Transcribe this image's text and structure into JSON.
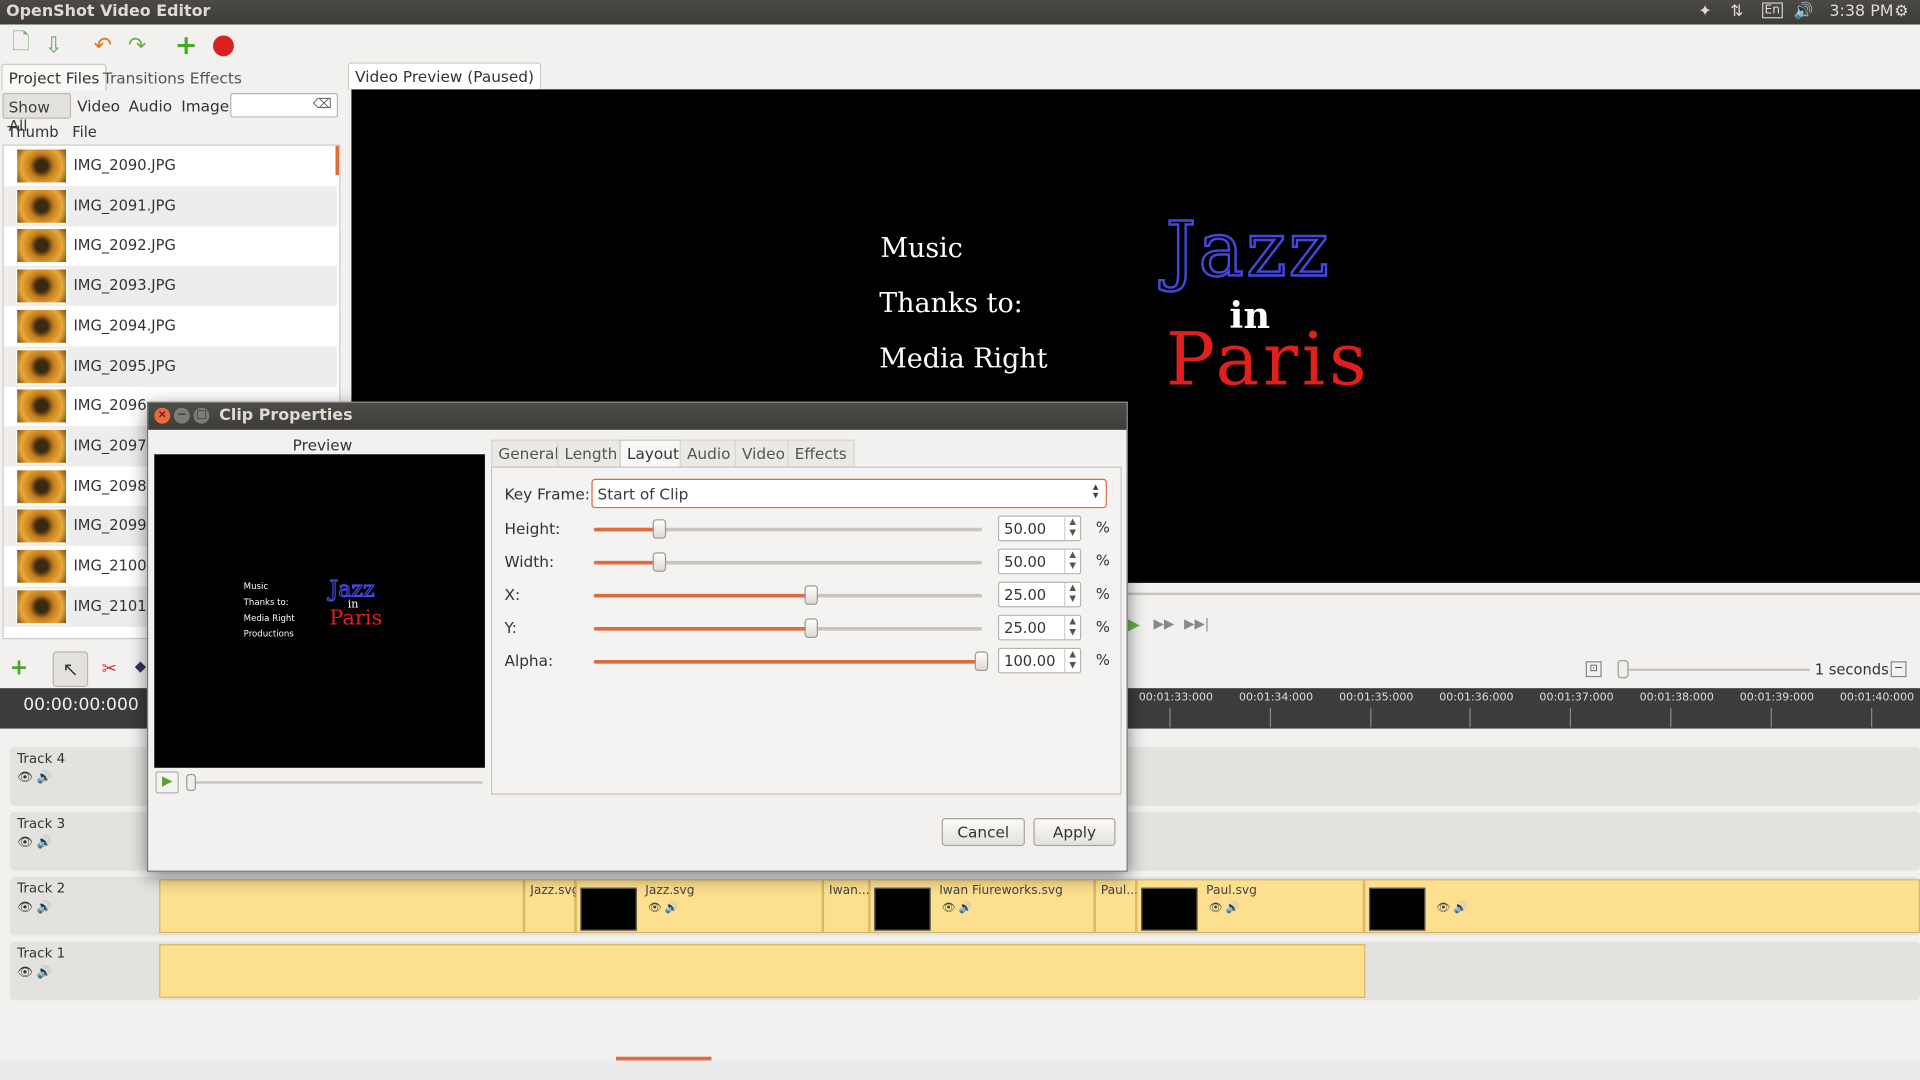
{
  "app": {
    "title": "OpenShot Video Editor"
  },
  "top_panel": {
    "keyboard": "En",
    "clock": "3:38 PM"
  },
  "left_tabs": [
    "Project Files",
    "Transitions",
    "Effects"
  ],
  "filters": {
    "show_all": "Show All",
    "video": "Video",
    "audio": "Audio",
    "image": "Image",
    "search_placeholder": ""
  },
  "file_columns": {
    "thumb": "Thumb",
    "file": "File"
  },
  "files": [
    "IMG_2090.JPG",
    "IMG_2091.JPG",
    "IMG_2092.JPG",
    "IMG_2093.JPG",
    "IMG_2094.JPG",
    "IMG_2095.JPG",
    "IMG_2096...",
    "IMG_2097...",
    "IMG_2098...",
    "IMG_2099...",
    "IMG_2100...",
    "IMG_2101..."
  ],
  "preview_tab": "Video Preview (Paused)",
  "preview": {
    "credits": [
      "Music",
      "Thanks to:",
      "Media Right"
    ],
    "logo": {
      "word1": "Jazz",
      "word2": "in",
      "word3": "Paris"
    }
  },
  "timeline": {
    "timecode": "00:00:00:000",
    "zoom_label": "1 seconds",
    "ruler": [
      "00:01:33:000",
      "00:01:34:000",
      "00:01:35:000",
      "00:01:36:000",
      "00:01:37:000",
      "00:01:38:000",
      "00:01:39:000",
      "00:01:40:000"
    ],
    "tracks": [
      "Track 4",
      "Track 3",
      "Track 2",
      "Track 1"
    ],
    "track2_clips": [
      "Jazz.svg",
      "Jazz.svg",
      "Iwan...",
      "Iwan Fiureworks.svg",
      "Paul...",
      "Paul.svg"
    ]
  },
  "dialog": {
    "title": "Clip Properties",
    "preview_label": "Preview",
    "preview_credits": [
      "Music",
      "Thanks to:",
      "Media Right",
      "Productions"
    ],
    "tabs": [
      "General",
      "Length",
      "Layout",
      "Audio",
      "Video",
      "Effects"
    ],
    "active_tab": "Layout",
    "keyframe_label": "Key Frame:",
    "keyframe_value": "Start of Clip",
    "props": [
      {
        "label": "Height:",
        "value": "50.00",
        "level": 0.17
      },
      {
        "label": "Width:",
        "value": "50.00",
        "level": 0.17
      },
      {
        "label": "X:",
        "value": "25.00",
        "level": 0.56
      },
      {
        "label": "Y:",
        "value": "25.00",
        "level": 0.56
      },
      {
        "label": "Alpha:",
        "value": "100.00",
        "level": 1.0
      }
    ],
    "unit": "%",
    "cancel": "Cancel",
    "apply": "Apply"
  },
  "colors": {
    "accent": "#e16a3e",
    "clip": "#fcdf8f",
    "jazz": "#3a3ad8",
    "paris": "#e0201e"
  }
}
